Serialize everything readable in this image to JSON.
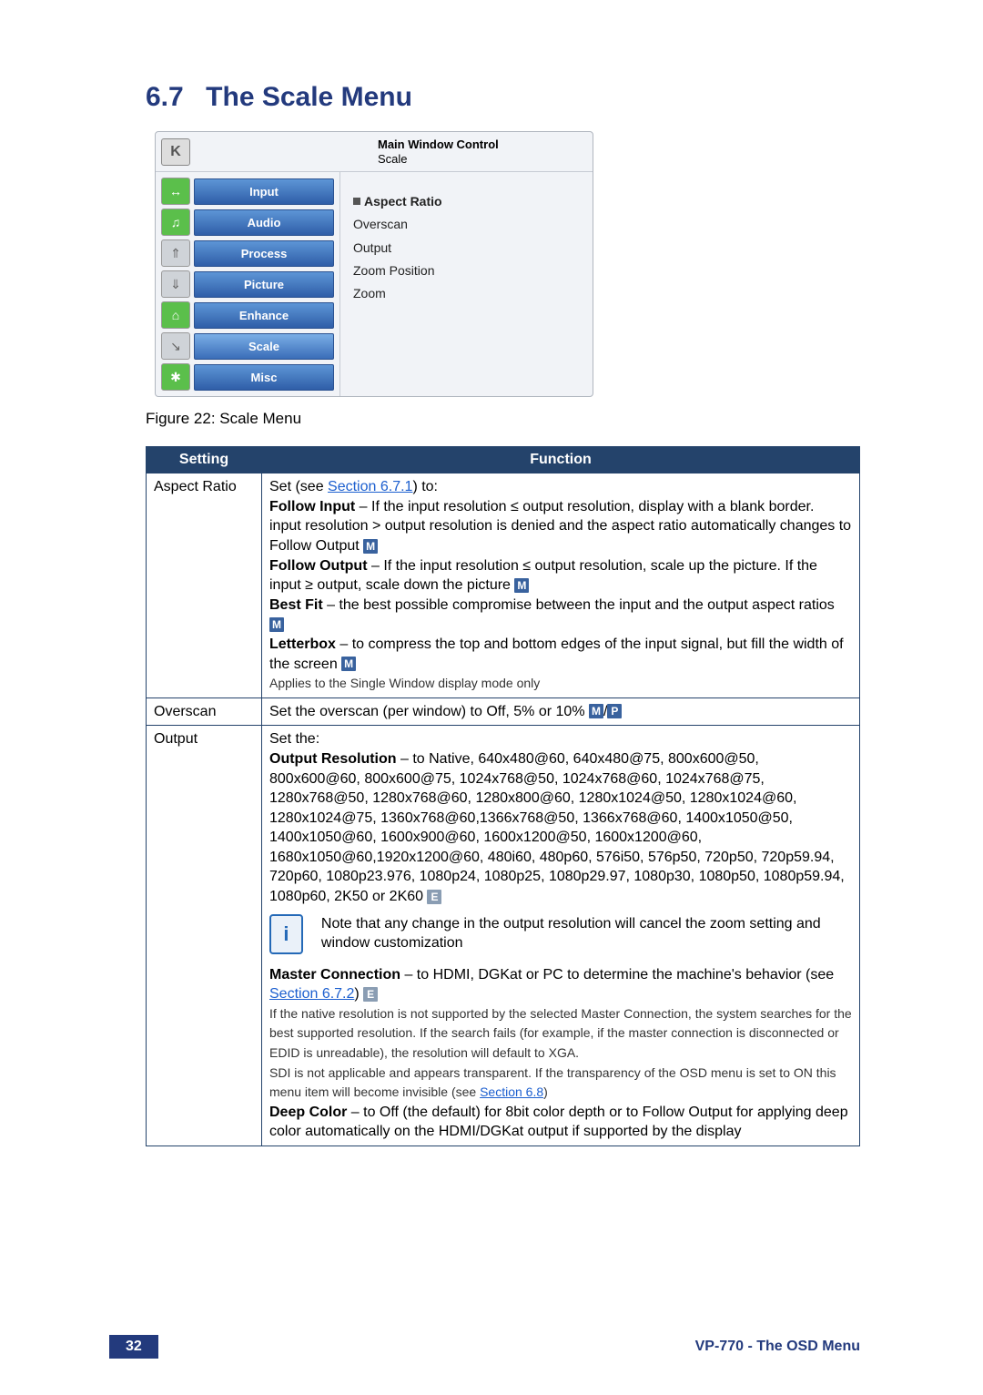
{
  "heading": {
    "num": "6.7",
    "title": "The Scale Menu"
  },
  "osd": {
    "title_bold": "Main Window Control",
    "title_sub": "Scale",
    "side": [
      {
        "icon": "↔",
        "label": "Input",
        "color": "green"
      },
      {
        "icon": "♫",
        "label": "Audio",
        "color": "green"
      },
      {
        "icon": "⇑",
        "label": "Process",
        "color": "gray"
      },
      {
        "icon": "⇓",
        "label": "Picture",
        "color": "gray"
      },
      {
        "icon": "⌂",
        "label": "Enhance",
        "color": "green"
      },
      {
        "icon": "↘",
        "label": "Scale",
        "color": "gray"
      },
      {
        "icon": "✱",
        "label": "Misc",
        "color": "green"
      }
    ],
    "right": {
      "items": [
        "Aspect Ratio",
        "Overscan",
        "Output",
        "Zoom Position",
        "Zoom"
      ],
      "selected": 0
    }
  },
  "caption": "Figure 22: Scale Menu",
  "th": {
    "setting": "Setting",
    "function": "Function"
  },
  "tags": {
    "M": "M",
    "P": "P",
    "E": "E"
  },
  "rows": {
    "aspect": {
      "setting": "Aspect Ratio",
      "intro_pre": "Set (see ",
      "intro_link": "Section 6.7.1",
      "intro_post": ") to:",
      "fi_b": "Follow Input",
      "fi": " – If the input resolution ≤ output resolution, display with a blank border.",
      "fi2": "input resolution > output resolution is denied and the aspect ratio automatically changes to Follow Output ",
      "fo_b": "Follow Output",
      "fo": " – If the input resolution ≤ output resolution, scale up the picture. If the input ≥ output, scale down the picture ",
      "bf_b": "Best Fit",
      "bf": " – the best possible compromise between the input and the output aspect ratios ",
      "lb_b": "Letterbox",
      "lb": " – to compress the top and bottom edges of the input signal, but fill the width of the screen ",
      "note": "Applies to the Single Window display mode only"
    },
    "overscan": {
      "setting": "Overscan",
      "text": "Set the overscan (per window) to Off, 5% or 10% "
    },
    "output": {
      "setting": "Output",
      "intro": "Set the:",
      "res_b": "Output Resolution",
      "res": " – to Native, 640x480@60, 640x480@75, 800x600@50, 800x600@60, 800x600@75, 1024x768@50, 1024x768@60, 1024x768@75, 1280x768@50, 1280x768@60, 1280x800@60, 1280x1024@50, 1280x1024@60, 1280x1024@75, 1360x768@60,1366x768@50, 1366x768@60, 1400x1050@50, 1400x1050@60, 1600x900@60, 1600x1200@50, 1600x1200@60, 1680x1050@60,1920x1200@60, 480i60, 480p60, 576i50, 576p50, 720p50, 720p59.94, 720p60, 1080p23.976, 1080p24, 1080p25, 1080p29.97, 1080p30, 1080p50, 1080p59.94, 1080p60, 2K50 or 2K60 ",
      "note_text": "Note that any change in the output resolution will cancel the zoom setting and window customization",
      "mc_b": "Master Connection",
      "mc_pre": " – to HDMI, DGKat or PC to determine the machine's behavior (see ",
      "mc_link": "Section 6.7.2",
      "mc_post": ") ",
      "native": "If the native resolution is not supported by the selected Master Connection, the system searches for the best supported resolution. If the search fails (for example, if the master connection is disconnected or EDID is unreadable), the resolution will default to XGA.",
      "sdi_pre": "SDI is not applicable and appears transparent. If the transparency of the OSD menu is set to ON this menu item will become invisible (see ",
      "sdi_link": "Section 6.8",
      "sdi_post": ")",
      "dc_b": "Deep Color",
      "dc": " – to Off (the default) for 8bit color depth or to Follow Output for applying deep color automatically on the HDMI/DGKat output if supported by the display"
    }
  },
  "footer": {
    "page": "32",
    "title": "VP-770 - The OSD Menu"
  }
}
